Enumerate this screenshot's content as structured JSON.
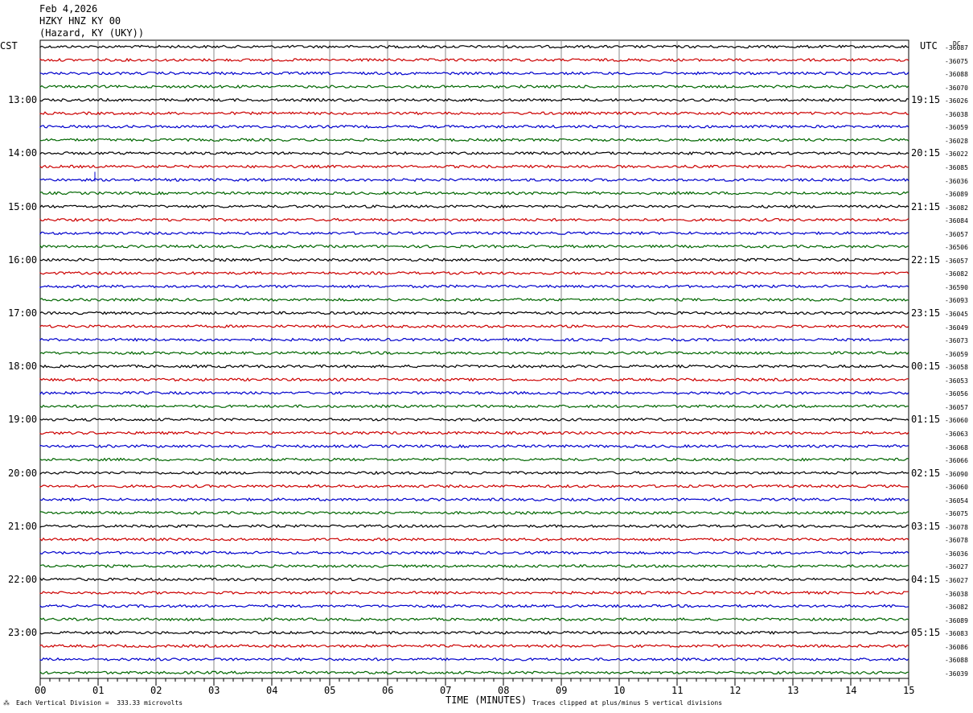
{
  "header": {
    "date": "Feb 4,2026",
    "station": "HZKY HNZ KY 00",
    "location": "(Hazard, KY (UKY))"
  },
  "left_tz": "CST",
  "right_tz": "UTC",
  "dc_label": "DC",
  "left_hours": [
    "13:00",
    "14:00",
    "15:00",
    "16:00",
    "17:00",
    "18:00",
    "19:00",
    "20:00",
    "21:00",
    "22:00",
    "23:00"
  ],
  "right_hours": [
    "19:15",
    "20:15",
    "21:15",
    "22:15",
    "23:15",
    "00:15",
    "01:15",
    "02:15",
    "03:15",
    "04:15",
    "05:15"
  ],
  "minute_ticks": [
    "00",
    "01",
    "02",
    "03",
    "04",
    "05",
    "06",
    "07",
    "08",
    "09",
    "10",
    "11",
    "12",
    "13",
    "14",
    "15"
  ],
  "dc_offsets": [
    "-36087",
    "-36075",
    "-36088",
    "-36070",
    "-36026",
    "-36038",
    "-36059",
    "-36028",
    "-36022",
    "-36085",
    "-36036",
    "-36089",
    "-36082",
    "-36084",
    "-36057",
    "-36506",
    "-36057",
    "-36082",
    "-36590",
    "-36093",
    "-36045",
    "-36049",
    "-36073",
    "-36059",
    "-36058",
    "-36053",
    "-36056",
    "-36057",
    "-36060",
    "-36063",
    "-36068",
    "-36066",
    "-36090",
    "-36060",
    "-36054",
    "-36075",
    "-36078",
    "-36078",
    "-36036",
    "-36027",
    "-36027",
    "-36038",
    "-36082",
    "-36089",
    "-36083",
    "-36086",
    "-36088",
    "-36039"
  ],
  "trace_colors": [
    "#000000",
    "#cc0000",
    "#0000cc",
    "#006600"
  ],
  "x_axis_label": "TIME (MINUTES)",
  "footer_left": "Each Vertical Division =  333.33 microvolts",
  "footer_right": "Traces clipped at plus/minus 5 vertical divisions"
}
